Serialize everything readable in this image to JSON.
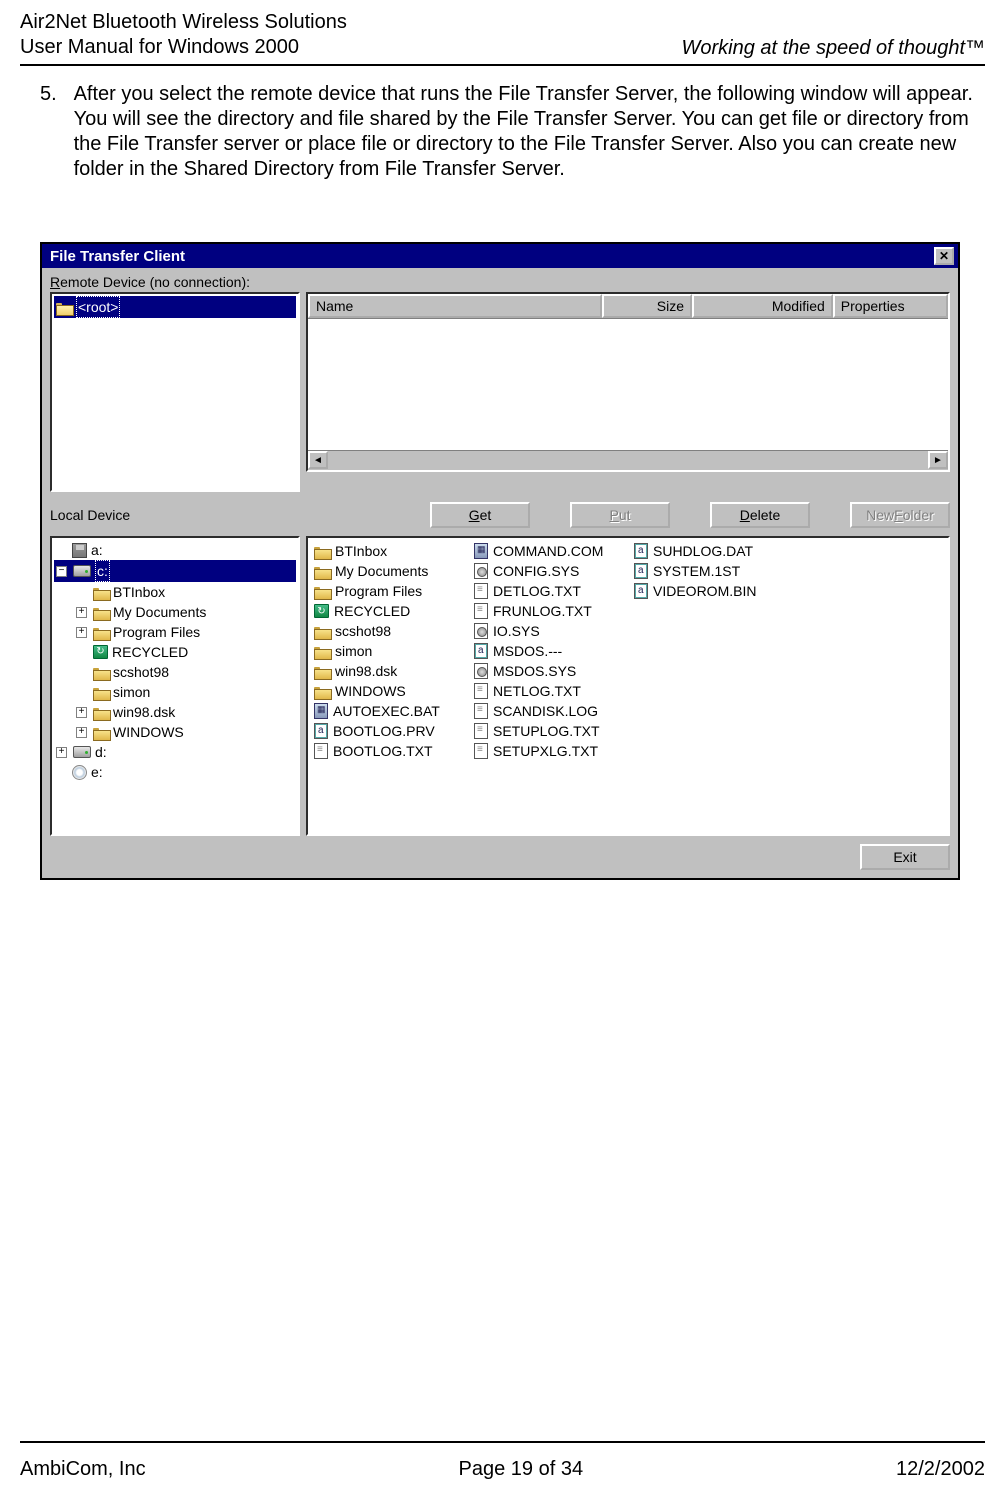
{
  "header": {
    "left1": "Air2Net Bluetooth Wireless Solutions",
    "left2": "User Manual for Windows 2000",
    "right_plain": "Working at the speed of thought",
    "tm": "™"
  },
  "body": {
    "num": "5.",
    "para": "After you select the remote device that runs the File Transfer Server, the following window will appear. You will see the directory and file shared by the File Transfer Server. You can get file or directory from the File Transfer server or place file or directory to the File Transfer Server. Also you can create new folder in the Shared Directory from File Transfer Server."
  },
  "dialog": {
    "title": "File Transfer Client",
    "close_sym": "✕",
    "remote_label_pre": "R",
    "remote_label_rest": "emote Device (no connection):",
    "remote_root": "<root>",
    "cols": {
      "name": "Name",
      "size": "Size",
      "modified": "Modified",
      "properties": "Properties"
    },
    "local_label": "Local Device",
    "buttons": {
      "get_u": "G",
      "get_rest": "et",
      "put_u": "P",
      "put_rest": "ut",
      "del_u": "D",
      "del_rest": "elete",
      "newfold_pre": "New ",
      "newfold_u": "F",
      "newfold_rest": "older",
      "exit": "Exit"
    }
  },
  "local_tree": {
    "a": "a:",
    "c": "c:",
    "c_children": [
      {
        "label": "BTInbox",
        "pm": ""
      },
      {
        "label": "My Documents",
        "pm": "+"
      },
      {
        "label": "Program Files",
        "pm": "+"
      },
      {
        "label": "RECYCLED",
        "pm": "",
        "icon": "rec"
      },
      {
        "label": "scshot98",
        "pm": ""
      },
      {
        "label": "simon",
        "pm": ""
      },
      {
        "label": "win98.dsk",
        "pm": "+"
      },
      {
        "label": "WINDOWS",
        "pm": "+"
      }
    ],
    "d": "d:",
    "e": "e:"
  },
  "local_list": {
    "col1": [
      {
        "t": "folder",
        "label": "BTInbox"
      },
      {
        "t": "folder",
        "label": "My Documents"
      },
      {
        "t": "folder",
        "label": "Program Files"
      },
      {
        "t": "rec",
        "label": "RECYCLED"
      },
      {
        "t": "folder",
        "label": "scshot98"
      },
      {
        "t": "folder",
        "label": "simon"
      },
      {
        "t": "folder",
        "label": "win98.dsk"
      },
      {
        "t": "folder",
        "label": "WINDOWS"
      },
      {
        "t": "exe",
        "label": "AUTOEXEC.BAT"
      },
      {
        "t": "bin",
        "label": "BOOTLOG.PRV"
      },
      {
        "t": "txt",
        "label": "BOOTLOG.TXT"
      }
    ],
    "col2": [
      {
        "t": "exe",
        "label": "COMMAND.COM"
      },
      {
        "t": "sys",
        "label": "CONFIG.SYS"
      },
      {
        "t": "txt",
        "label": "DETLOG.TXT"
      },
      {
        "t": "txt",
        "label": "FRUNLOG.TXT"
      },
      {
        "t": "sys",
        "label": "IO.SYS"
      },
      {
        "t": "bin",
        "label": "MSDOS.---"
      },
      {
        "t": "sys",
        "label": "MSDOS.SYS"
      },
      {
        "t": "txt",
        "label": "NETLOG.TXT"
      },
      {
        "t": "txt",
        "label": "SCANDISK.LOG"
      },
      {
        "t": "txt",
        "label": "SETUPLOG.TXT"
      },
      {
        "t": "txt",
        "label": "SETUPXLG.TXT"
      }
    ],
    "col3": [
      {
        "t": "bin",
        "label": "SUHDLOG.DAT"
      },
      {
        "t": "bin",
        "label": "SYSTEM.1ST"
      },
      {
        "t": "bin",
        "label": "VIDEOROM.BIN"
      }
    ]
  },
  "footer": {
    "left": "AmbiCom, Inc",
    "center": "Page 19 of 34",
    "right": "12/2/2002"
  }
}
